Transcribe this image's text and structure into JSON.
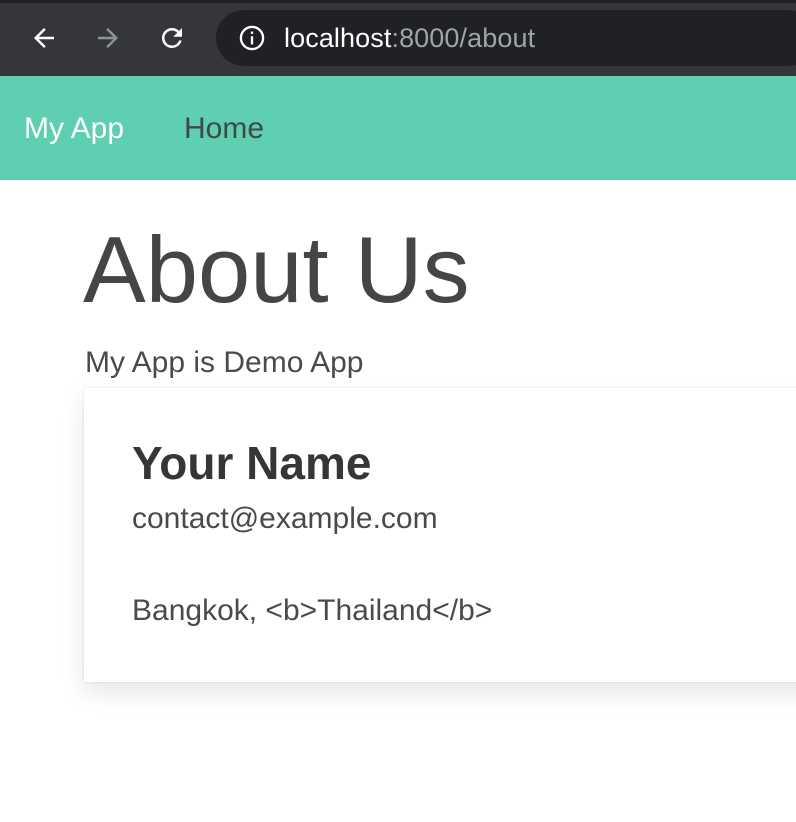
{
  "browser": {
    "url_host": "localhost",
    "url_rest": ":8000/about",
    "icons": {
      "back": "arrow-left-icon",
      "forward": "arrow-right-icon",
      "reload": "reload-icon",
      "site_info": "info-icon"
    }
  },
  "navbar": {
    "brand": "My App",
    "links": [
      {
        "label": "Home"
      }
    ]
  },
  "page": {
    "title": "About Us",
    "subtitle": "My App is Demo App"
  },
  "card": {
    "name": "Your Name",
    "email": "contact@example.com",
    "location": "Bangkok, <b>Thailand</b>"
  },
  "colors": {
    "navbar_background": "#5ecfb1",
    "browser_chrome": "#35363a",
    "omnibox_background": "#202124",
    "heading_text": "#454545",
    "body_text": "#4a4a4a"
  }
}
